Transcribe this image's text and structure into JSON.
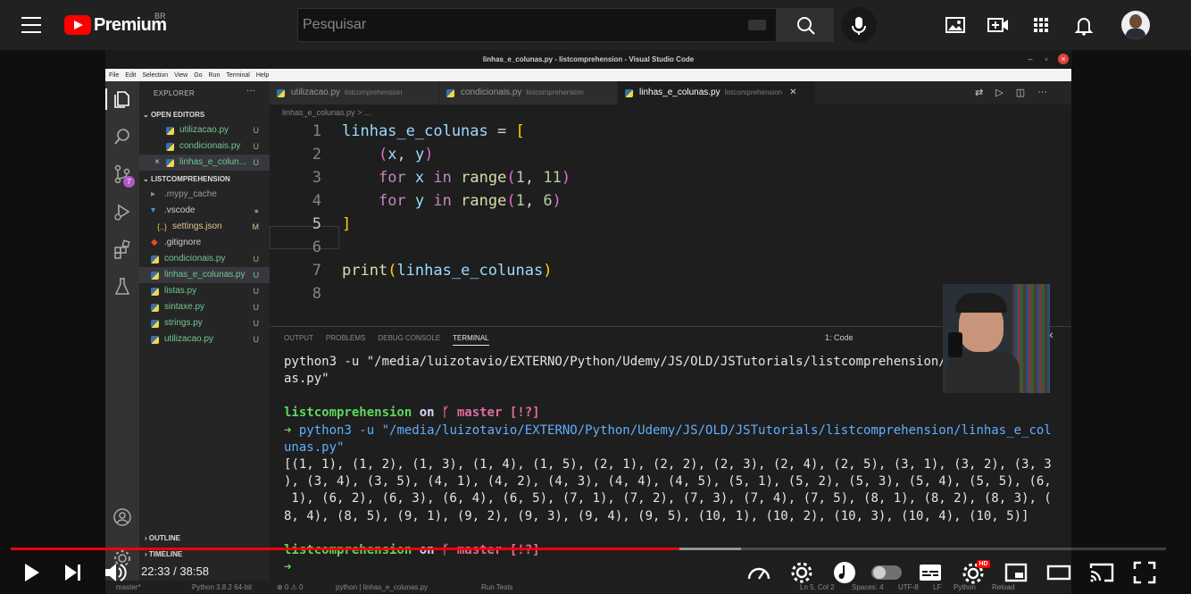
{
  "youtube": {
    "logo_text": "Premium",
    "region": "BR",
    "search_placeholder": "Pesquisar",
    "current_time": "22:33",
    "duration": "38:58",
    "time_sep": " / ",
    "played_fraction": 0.579,
    "buffered_fraction": 0.632,
    "hd_badge": "HD",
    "icons": [
      "menu-icon",
      "youtube-logo-icon",
      "search-icon",
      "mic-icon",
      "image-icon",
      "create-video-icon",
      "apps-icon",
      "notifications-icon",
      "avatar",
      "play-icon",
      "next-icon",
      "volume-icon",
      "speed-icon",
      "settings-icon",
      "autoplay-toggle",
      "captions-icon",
      "miniplayer-icon",
      "theater-icon",
      "cast-icon",
      "fullscreen-icon"
    ]
  },
  "vscode": {
    "window_title": "linhas_e_colunas.py - listcomprehension - Visual Studio Code",
    "menu": [
      "File",
      "Edit",
      "Selection",
      "View",
      "Go",
      "Run",
      "Terminal",
      "Help"
    ],
    "explorer_title": "EXPLORER",
    "open_editors_title": "OPEN EDITORS",
    "open_editors": [
      {
        "name": "utilizacao.py",
        "status": "U"
      },
      {
        "name": "condicionais.py",
        "status": "U"
      },
      {
        "name": "linhas_e_colun...",
        "status": "U"
      }
    ],
    "folder_title": "LISTCOMPREHENSION",
    "files": [
      {
        "name": ".mypy_cache",
        "status": ""
      },
      {
        "name": ".vscode",
        "status": ""
      },
      {
        "name": "settings.json",
        "status": "M"
      },
      {
        "name": ".gitignore",
        "status": ""
      },
      {
        "name": "condicionais.py",
        "status": "U"
      },
      {
        "name": "linhas_e_colunas.py",
        "status": "U"
      },
      {
        "name": "listas.py",
        "status": "U"
      },
      {
        "name": "sintaxe.py",
        "status": "U"
      },
      {
        "name": "strings.py",
        "status": "U"
      },
      {
        "name": "utilizacao.py",
        "status": "U"
      }
    ],
    "outline_title": "OUTLINE",
    "timeline_title": "TIMELINE",
    "activity_badge": "7",
    "tabs": [
      {
        "name": "utilizacao.py",
        "folder": "listcomprehension"
      },
      {
        "name": "condicionais.py",
        "folder": "listcomprehension"
      },
      {
        "name": "linhas_e_colunas.py",
        "folder": "listcomprehension"
      }
    ],
    "breadcrumb": "linhas_e_colunas.py > ...",
    "line_numbers": [
      "1",
      "2",
      "3",
      "4",
      "5",
      "6",
      "7",
      "8"
    ],
    "panel_tabs": [
      "OUTPUT",
      "PROBLEMS",
      "DEBUG CONSOLE",
      "TERMINAL"
    ],
    "terminal_select": "1: Code",
    "terminal": {
      "l1": "python3 -u \"/media/luizotavio/EXTERNO/Python/Udemy/JS/OLD/JSTutorials/listcomprehension/linh",
      "l2": "as.py\"",
      "prompt_dir": "listcomprehension",
      "prompt_on": " on ",
      "prompt_branch": "ᚴ master",
      "prompt_flags": " [!?]",
      "cmd1": " python3 -u \"/media/luizotavio/EXTERNO/Python/Udemy/JS/OLD/JSTutorials/listcomprehension/linhas_e_col",
      "cmd2": "unas.py\"",
      "out1": "[(1, 1), (1, 2), (1, 3), (1, 4), (1, 5), (2, 1), (2, 2), (2, 3), (2, 4), (2, 5), (3, 1), (3, 2), (3, 3",
      "out2": "), (3, 4), (3, 5), (4, 1), (4, 2), (4, 3), (4, 4), (4, 5), (5, 1), (5, 2), (5, 3), (5, 4), (5, 5), (6,",
      "out3": " 1), (6, 2), (6, 3), (6, 4), (6, 5), (7, 1), (7, 2), (7, 3), (7, 4), (7, 5), (8, 1), (8, 2), (8, 3), (",
      "out4": "8, 4), (8, 5), (9, 1), (9, 2), (9, 3), (9, 4), (9, 5), (10, 1), (10, 2), (10, 3), (10, 4), (10, 5)]",
      "arrow": "➜"
    },
    "status": {
      "branch": "master*",
      "python": "Python 3.8.2 64-bit",
      "errors": "⊗ 0 ⚠ 0",
      "lang_crumb": "python | linhas_e_colunas.py",
      "run_tests": "Run Tests",
      "position": "Ln 5, Col 2",
      "spaces": "Spaces: 4",
      "encoding": "UTF-8",
      "eol": "LF",
      "language": "Python",
      "reload": "Reload"
    }
  }
}
